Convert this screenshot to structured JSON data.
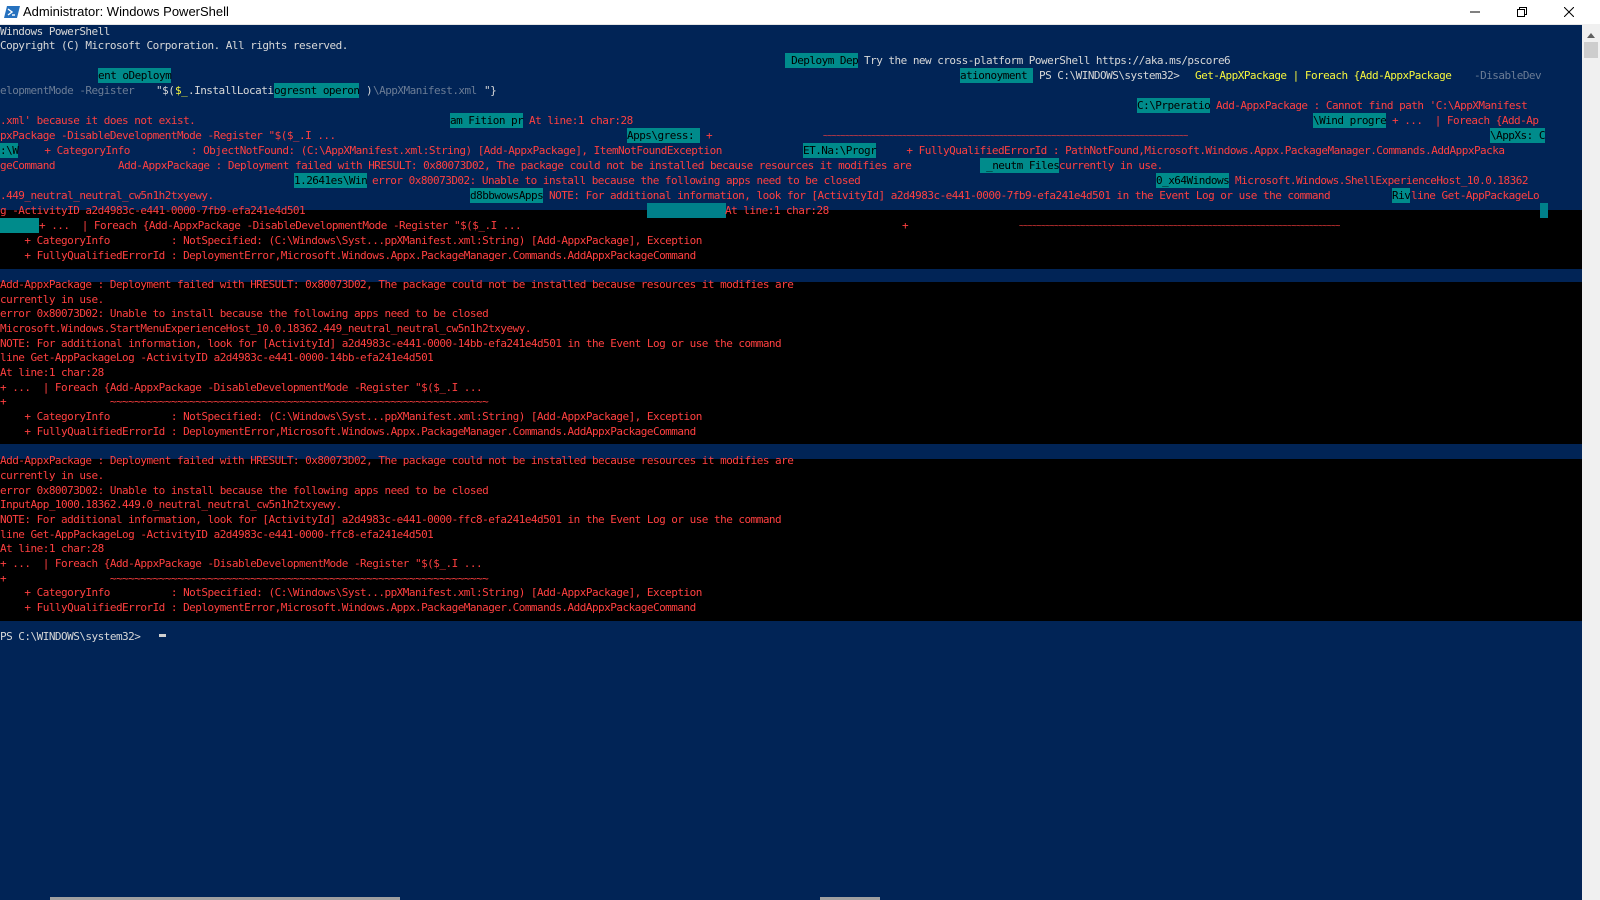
{
  "window": {
    "title": "Administrator: Windows PowerShell",
    "icon": "powershell-icon",
    "controls": {
      "minimize": "minimize-icon",
      "restore": "restore-icon",
      "close": "close-icon"
    }
  },
  "colors": {
    "console_bg": "#012456",
    "error_band_bg": "#000000",
    "text": "#cccccc",
    "error": "#ff4040",
    "command": "#f7f73c",
    "highlight": "#008b8b"
  },
  "console": {
    "header": [
      "Windows PowerShell",
      "Copyright (C) Microsoft Corporation. All rights reserved."
    ],
    "garbled": {
      "l1_hl": " Deploym Dep",
      "l1_text": "Try the new cross-platform PowerShell https://aka.ms/pscore6",
      "l2_hl_a": "ent oDeploym",
      "l2_hl_b": "ationoyment ",
      "l2_prompt": "PS C:\\WINDOWS\\system32> ",
      "l2_cmd": "Get-AppXPackage | Foreach {Add-AppxPackage ",
      "l2_param": "-DisableDev",
      "l3_a": "elopmentMode -Register ",
      "l3_b": "\"$(",
      "l3_c": "$_",
      "l3_d": ".InstallLocati",
      "l3_hl": "ogresnt operon",
      "l3_e": ")",
      "l3_f": "\\AppXManifest.xml",
      "l3_g": "\"}",
      "l4_hl": "C:\\Prperatio",
      "l4_err": "Add-AppxPackage : Cannot find path 'C:\\AppXManifest",
      "l5_err_a": ".xml' because it does not exist.",
      "l5_hl_a": "am Fition pr",
      "l5_err_b": "At line:1 char:28",
      "l5_hl_b": "\\Wind progre",
      "l5_err_c": "+ ...  | Foreach {Add-Ap",
      "l6_err_a": "pxPackage -DisableDevelopmentMode -Register \"$($_.I ...",
      "l6_hl_a": "Apps\\gress: ",
      "l6_err_b": "+",
      "l6_tilde": "~~~~~~~~~~~~~~~~~~~~~~~~~~~~~~~~~~~~~~~~~~~~~~~~~~~~~~~~~~~~~~~~~~~~~~~~~~~~~~~~~~~",
      "l6_hl_b": "\\AppXs: C",
      "l7_hl_a": ":\\W",
      "l7_err_a": "    + CategoryInfo          : ObjectNotFound: (C:\\AppXManifest.xml:String) [Add-AppxPackage], ItemNotFoundException",
      "l7_hl_b": "ET.Na:\\Progr",
      "l7_err_b": "    + FullyQualifiedErrorId : PathNotFound,Microsoft.Windows.Appx.PackageManager.Commands.AddAppxPacka",
      "l8_err_a": "geCommand",
      "l8_err_b": "Add-AppxPackage : Deployment failed with HRESULT: 0x80073D02, The package could not be installed because resources it modifies are ",
      "l8_hl": " _neutm Files",
      "l8_err_c": "currently in use.",
      "l9_hl_a": "1.2641es\\Win",
      "l9_err_a": "error 0x80073D02: Unable to install because the following apps need to be closed",
      "l9_hl_b": "0_x64Windows",
      "l9_err_b": "Microsoft.Windows.ShellExperienceHost_10.0.18362",
      "l10_err_a": ".449_neutral_neutral_cw5n1h2txyewy.",
      "l10_hl_a": "d8bbwowsApps",
      "l10_err_b": "NOTE: For additional information, look for [ActivityId] a2d4983c-e441-0000-7fb9-efa241e4d501 in the Event Log or use the command ",
      "l10_hl_b": "Riv",
      "l10_err_c": "line Get-AppPackageLo",
      "l11_err_a": "g -ActivityID a2d4983c-e441-0000-7fb9-efa241e4d501",
      "l11_err_b": "At line:1 char:28",
      "l12_err_a": "+ ...  | Foreach {Add-AppxPackage -DisableDevelopmentMode -Register \"$($_.I ...",
      "l12_err_b": "+",
      "l12_tilde": "~~~~~~~~~~~~~~~~~~~~~~~~~~~~~~~~~~~~~~~~~~~~~~~~~~~~~~~~~~~~~~~~~~~~~~~~~",
      "l13": "    + CategoryInfo          : NotSpecified: (C:\\Windows\\Syst...ppXManifest.xml:String) [Add-AppxPackage], Exception",
      "l14": "    + FullyQualifiedErrorId : DeploymentError,Microsoft.Windows.Appx.PackageManager.Commands.AddAppxPackageCommand"
    },
    "error_block_1": [
      "Add-AppxPackage : Deployment failed with HRESULT: 0x80073D02, The package could not be installed because resources it modifies are",
      "currently in use.",
      "error 0x80073D02: Unable to install because the following apps need to be closed",
      "Microsoft.Windows.StartMenuExperienceHost_10.0.18362.449_neutral_neutral_cw5n1h2txyewy.",
      "NOTE: For additional information, look for [ActivityId] a2d4983c-e441-0000-14bb-efa241e4d501 in the Event Log or use the command",
      "line Get-AppPackageLog -ActivityID a2d4983c-e441-0000-14bb-efa241e4d501",
      "At line:1 char:28",
      "+ ...  | Foreach {Add-AppxPackage -DisableDevelopmentMode -Register \"$($_.I ...",
      "+                 ~~~~~~~~~~~~~~~~~~~~~~~~~~~~~~~~~~~~~~~~~~~~~~~~~~~~~~~~~~~~~~",
      "    + CategoryInfo          : NotSpecified: (C:\\Windows\\Syst...ppXManifest.xml:String) [Add-AppxPackage], Exception",
      "    + FullyQualifiedErrorId : DeploymentError,Microsoft.Windows.Appx.PackageManager.Commands.AddAppxPackageCommand"
    ],
    "error_block_2": [
      "Add-AppxPackage : Deployment failed with HRESULT: 0x80073D02, The package could not be installed because resources it modifies are",
      "currently in use.",
      "error 0x80073D02: Unable to install because the following apps need to be closed",
      "InputApp_1000.18362.449.0_neutral_neutral_cw5n1h2txyewy.",
      "NOTE: For additional information, look for [ActivityId] a2d4983c-e441-0000-ffc8-efa241e4d501 in the Event Log or use the command",
      "line Get-AppPackageLog -ActivityID a2d4983c-e441-0000-ffc8-efa241e4d501",
      "At line:1 char:28",
      "+ ...  | Foreach {Add-AppxPackage -DisableDevelopmentMode -Register \"$($_.I ...",
      "+                 ~~~~~~~~~~~~~~~~~~~~~~~~~~~~~~~~~~~~~~~~~~~~~~~~~~~~~~~~~~~~~~",
      "    + CategoryInfo          : NotSpecified: (C:\\Windows\\Syst...ppXManifest.xml:String) [Add-AppxPackage], Exception",
      "    + FullyQualifiedErrorId : DeploymentError,Microsoft.Windows.Appx.PackageManager.Commands.AddAppxPackageCommand"
    ],
    "prompt": "PS C:\\WINDOWS\\system32> "
  }
}
